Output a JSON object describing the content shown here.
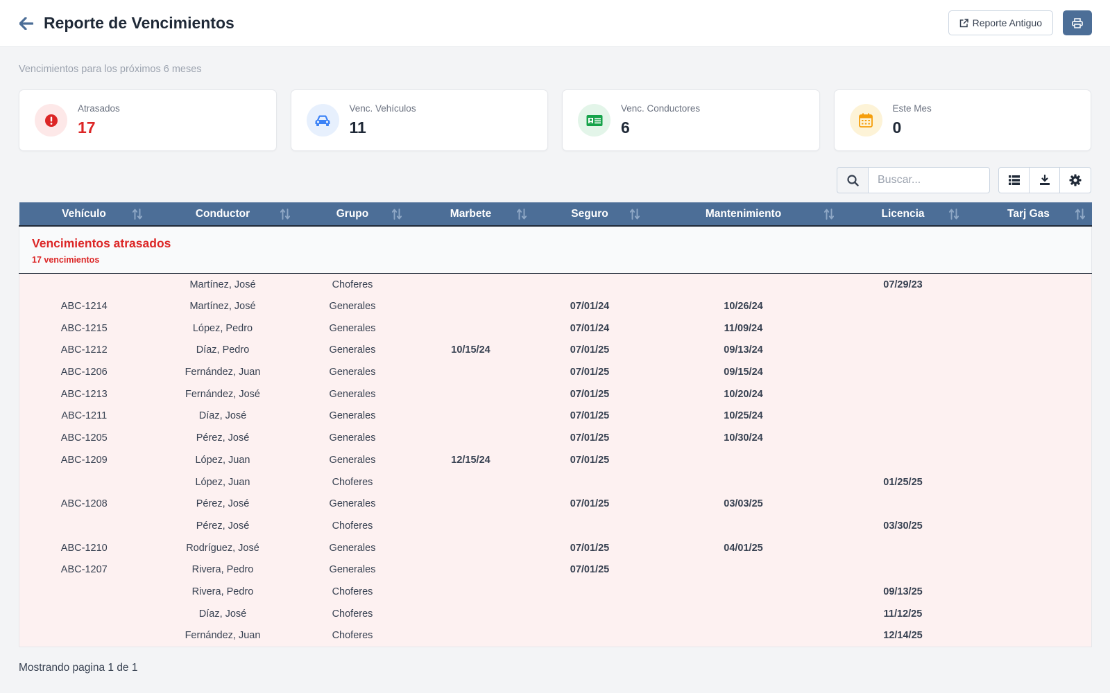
{
  "header": {
    "title": "Reporte de Vencimientos",
    "old_report_label": "Reporte Antiguo",
    "subtitle": "Vencimientos para los próximos 6 meses"
  },
  "cards": [
    {
      "label": "Atrasados",
      "value": "17",
      "icon": "exclamation-circle-icon",
      "color": "#dc2626",
      "bg": "#fde8e8"
    },
    {
      "label": "Venc. Vehículos",
      "value": "11",
      "icon": "car-icon",
      "color": "#3b82f6",
      "bg": "#e7f0fd"
    },
    {
      "label": "Venc. Conductores",
      "value": "6",
      "icon": "id-card-icon",
      "color": "#16a34a",
      "bg": "#e3f5e9"
    },
    {
      "label": "Este Mes",
      "value": "0",
      "icon": "calendar-icon",
      "color": "#f59e0b",
      "bg": "#fdf3d7"
    }
  ],
  "search": {
    "placeholder": "Buscar..."
  },
  "table": {
    "columns": [
      "Vehículo",
      "Conductor",
      "Grupo",
      "Marbete",
      "Seguro",
      "Mantenimiento",
      "Licencia",
      "Tarj Gas"
    ],
    "group": {
      "title": "Vencimientos atrasados",
      "count": "17 vencimientos"
    },
    "rows": [
      [
        "",
        "Martínez, José",
        "Choferes",
        "",
        "",
        "",
        "07/29/23",
        ""
      ],
      [
        "ABC-1214",
        "Martínez, José",
        "Generales",
        "",
        "07/01/24",
        "10/26/24",
        "",
        ""
      ],
      [
        "ABC-1215",
        "López, Pedro",
        "Generales",
        "",
        "07/01/24",
        "11/09/24",
        "",
        ""
      ],
      [
        "ABC-1212",
        "Díaz, Pedro",
        "Generales",
        "10/15/24",
        "07/01/25",
        "09/13/24",
        "",
        ""
      ],
      [
        "ABC-1206",
        "Fernández, Juan",
        "Generales",
        "",
        "07/01/25",
        "09/15/24",
        "",
        ""
      ],
      [
        "ABC-1213",
        "Fernández, José",
        "Generales",
        "",
        "07/01/25",
        "10/20/24",
        "",
        ""
      ],
      [
        "ABC-1211",
        "Díaz, José",
        "Generales",
        "",
        "07/01/25",
        "10/25/24",
        "",
        ""
      ],
      [
        "ABC-1205",
        "Pérez, José",
        "Generales",
        "",
        "07/01/25",
        "10/30/24",
        "",
        ""
      ],
      [
        "ABC-1209",
        "López, Juan",
        "Generales",
        "12/15/24",
        "07/01/25",
        "",
        "",
        ""
      ],
      [
        "",
        "López, Juan",
        "Choferes",
        "",
        "",
        "",
        "01/25/25",
        ""
      ],
      [
        "ABC-1208",
        "Pérez, José",
        "Generales",
        "",
        "07/01/25",
        "03/03/25",
        "",
        ""
      ],
      [
        "",
        "Pérez, José",
        "Choferes",
        "",
        "",
        "",
        "03/30/25",
        ""
      ],
      [
        "ABC-1210",
        "Rodríguez, José",
        "Generales",
        "",
        "07/01/25",
        "04/01/25",
        "",
        ""
      ],
      [
        "ABC-1207",
        "Rivera, Pedro",
        "Generales",
        "",
        "07/01/25",
        "",
        "",
        ""
      ],
      [
        "",
        "Rivera, Pedro",
        "Choferes",
        "",
        "",
        "",
        "09/13/25",
        ""
      ],
      [
        "",
        "Díaz, José",
        "Choferes",
        "",
        "",
        "",
        "11/12/25",
        ""
      ],
      [
        "",
        "Fernández, Juan",
        "Choferes",
        "",
        "",
        "",
        "12/14/25",
        ""
      ]
    ]
  },
  "footer": {
    "text": "Mostrando pagina 1 de 1"
  }
}
